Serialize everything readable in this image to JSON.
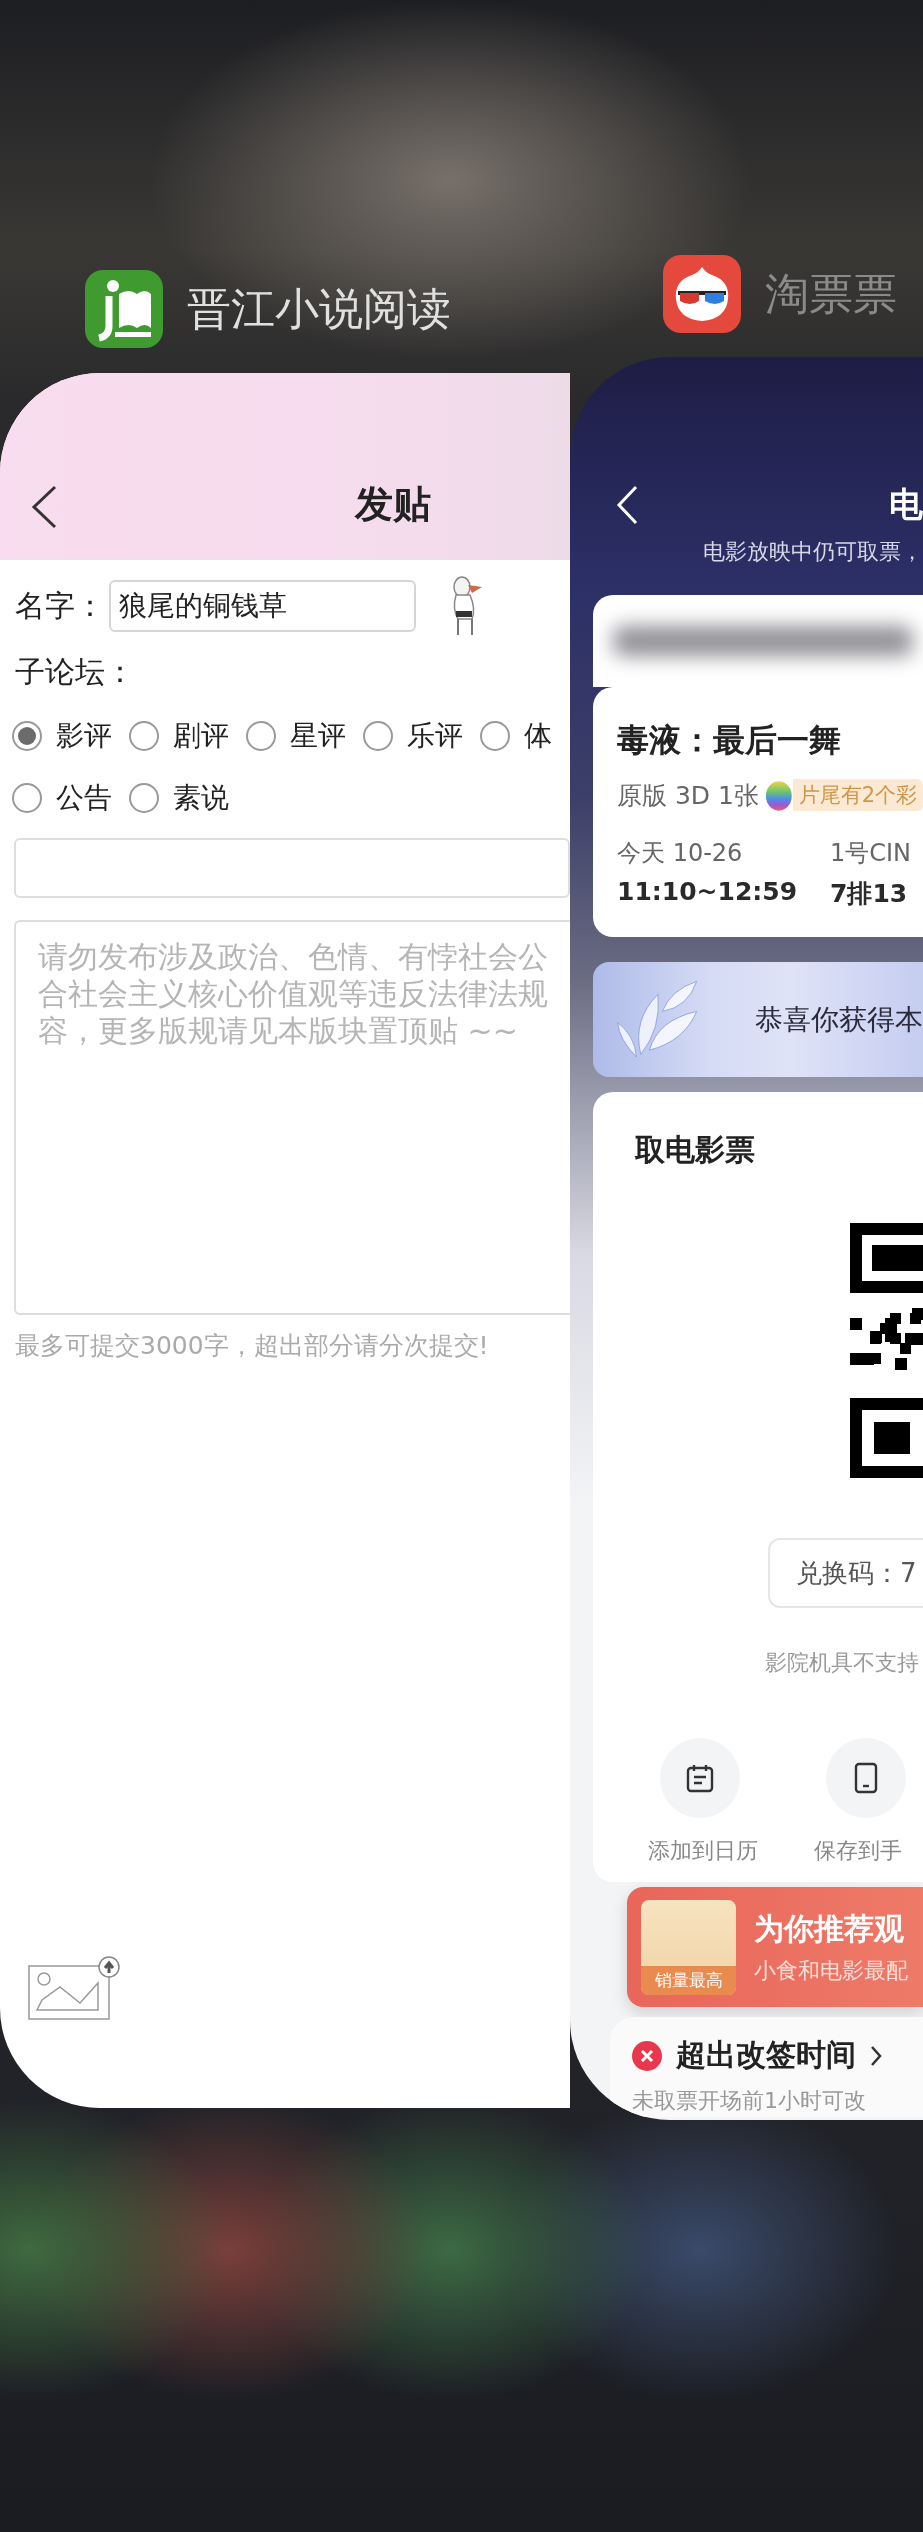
{
  "app_switcher": {
    "apps": [
      {
        "name": "晋江小说阅读",
        "kind": "book"
      },
      {
        "name": "淘票票",
        "kind": "glasses"
      }
    ]
  },
  "forum_post": {
    "title": "发贴",
    "name_label": "名字：",
    "name_value": "狼尾的铜钱草",
    "subforum_label": "子论坛：",
    "subforums": [
      {
        "label": "影评",
        "selected": true
      },
      {
        "label": "剧评",
        "selected": false
      },
      {
        "label": "星评",
        "selected": false
      },
      {
        "label": "乐评",
        "selected": false
      },
      {
        "label": "体",
        "selected": false
      },
      {
        "label": "公告",
        "selected": false
      },
      {
        "label": "素说",
        "selected": false
      }
    ],
    "content": {
      "placeholder": "请勿发布涉及政治、色情、有悖社会公合社会主义核心价值观等违反法律法规容，更多版规请见本版块置顶贴 ~~"
    },
    "hint": "最多可提交3000字，超出部分请分次提交!"
  },
  "ticket": {
    "title": "电",
    "subtitle": "电影放映中仍可取票，",
    "movie": {
      "title": "毒液：最后一舞",
      "format": "原版 3D 1张",
      "tag": "片尾有2个彩",
      "date": "今天 10-26",
      "hall": "1号CIN",
      "time": "11:10~12:59",
      "seat": "7排13"
    },
    "coupon": "恭喜你获得本",
    "pickup": {
      "title": "取电影票",
      "code": "兑换码：7",
      "note": "影院机具不支持",
      "actions": [
        {
          "label": "添加到日历",
          "kind": "calendar"
        },
        {
          "label": "保存到手",
          "kind": "phone"
        }
      ]
    },
    "promo": {
      "badge": "销量最高",
      "title": "为你推荐观",
      "subtitle": "小食和电影最配"
    },
    "notice": {
      "title": "超出改签时间",
      "subtitle": "未取票开场前1小时可改"
    }
  }
}
